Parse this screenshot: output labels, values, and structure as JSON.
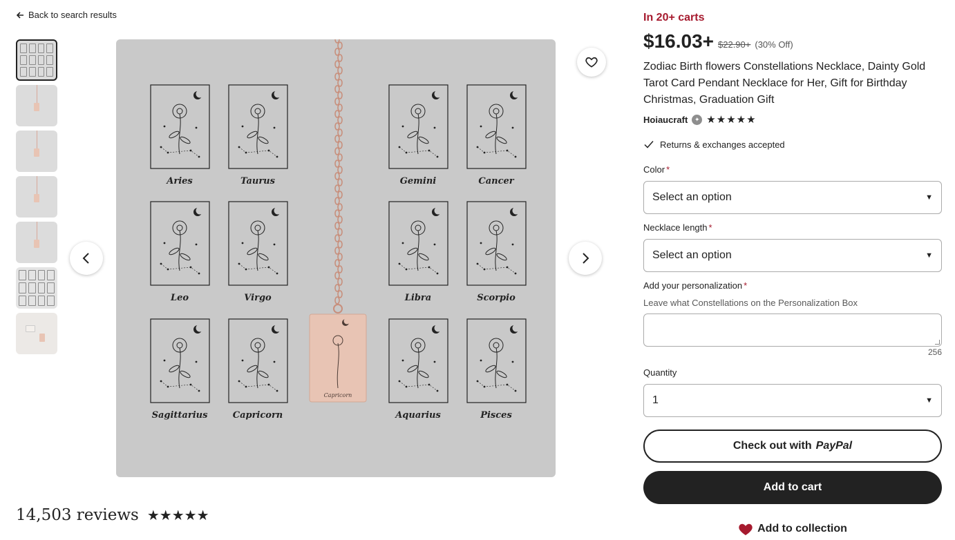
{
  "nav": {
    "back_label": "Back to search results"
  },
  "gallery": {
    "thumbnail_count": 7,
    "card_labels": [
      "Aries",
      "Taurus",
      "Gemini",
      "Cancer",
      "Leo",
      "Virgo",
      "Libra",
      "Scorpio",
      "Sagittarius",
      "Capricorn",
      "Aquarius",
      "Pisces"
    ],
    "pendant_label": "Capricorn"
  },
  "reviews": {
    "count_label": "14,503 reviews",
    "stars": "★★★★★"
  },
  "listing": {
    "carts_badge": "In 20+ carts",
    "price": "$16.03+",
    "original_price": "$22.90+",
    "discount": "(30% Off)",
    "title": "Zodiac Birth flowers Constellations Necklace, Dainty Gold Tarot Card Pendant Necklace for Her, Gift for Birthday Christmas, Graduation Gift",
    "shop_name": "Hoiaucraft",
    "shop_stars": "★★★★★",
    "returns": "Returns & exchanges accepted"
  },
  "form": {
    "color_label": "Color",
    "color_value": "Select an option",
    "length_label": "Necklace length",
    "length_value": "Select an option",
    "personalization_label": "Add your personalization",
    "personalization_hint": "Leave what Constellations on the Personalization Box",
    "personalization_remaining": "256",
    "quantity_label": "Quantity",
    "quantity_value": "1",
    "required_mark": "*"
  },
  "actions": {
    "paypal_prefix": "Check out with",
    "paypal_brand": "PayPal",
    "add_to_cart": "Add to cart",
    "add_to_collection": "Add to collection"
  },
  "colors": {
    "accent_red": "#a61a2e",
    "button_dark": "#222222",
    "image_bg": "#c9c9c9",
    "pendant": "#e8c4b4"
  }
}
